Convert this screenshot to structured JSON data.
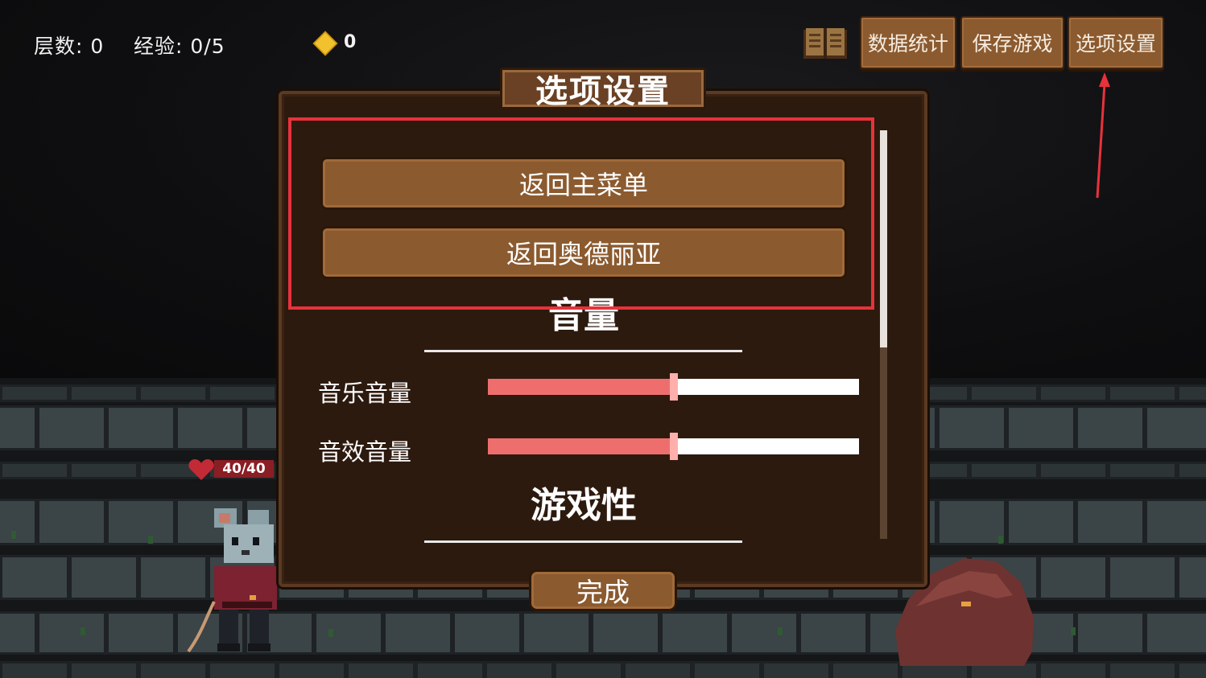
{
  "hud": {
    "floor_label": "层数:",
    "floor_value": "0",
    "exp_label": "经验:",
    "exp_value": "0/5",
    "coins": "0"
  },
  "top_buttons": {
    "stats": "数据统计",
    "save": "保存游戏",
    "options": "选项设置"
  },
  "dialog": {
    "title": "选项设置",
    "buttons": [
      "返回主菜单",
      "返回奥德丽亚"
    ],
    "volume_header": "音量",
    "music_volume_label": "音乐音量",
    "music_volume": 0.5,
    "sfx_volume_label": "音效音量",
    "sfx_volume": 0.5,
    "gameplay_header": "游戏性",
    "done": "完成"
  },
  "player": {
    "hp": "40/40"
  },
  "colors": {
    "button_brown": "#8b5a2f",
    "slider_fill": "#ee6e6e",
    "highlight": "#e8323c",
    "coin": "#f2c12e",
    "hp_bar": "#8b1d24"
  },
  "icons": [
    "coin-icon",
    "book-icon",
    "heart-icon"
  ]
}
